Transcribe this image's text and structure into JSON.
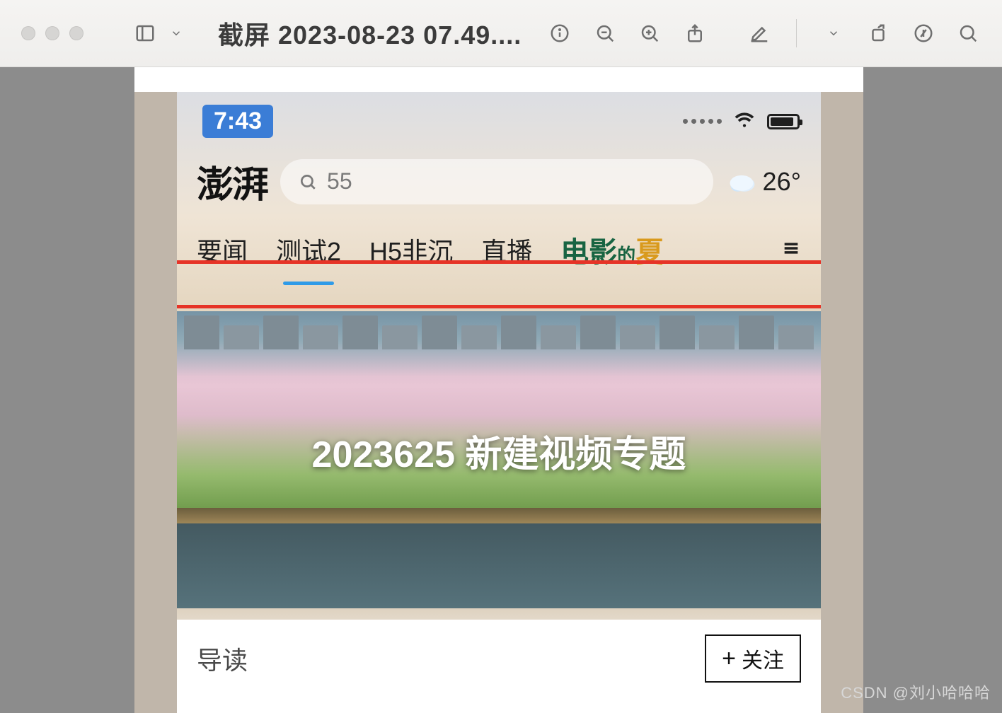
{
  "window": {
    "title": "截屏 2023-08-23 07.49...."
  },
  "statusbar": {
    "time": "7:43"
  },
  "app": {
    "brand": "澎湃",
    "search_text": "55",
    "temperature": "26°"
  },
  "tabs": [
    "要闻",
    "测试2",
    "H5非沉",
    "直播"
  ],
  "active_tab_index": 1,
  "movie_tab": {
    "a": "电影",
    "b": "的",
    "c": "夏"
  },
  "hero": {
    "title": "2023625  新建视频专题"
  },
  "bottom": {
    "guide": "导读",
    "follow": "关注"
  },
  "watermark": "CSDN @刘小哈哈哈"
}
